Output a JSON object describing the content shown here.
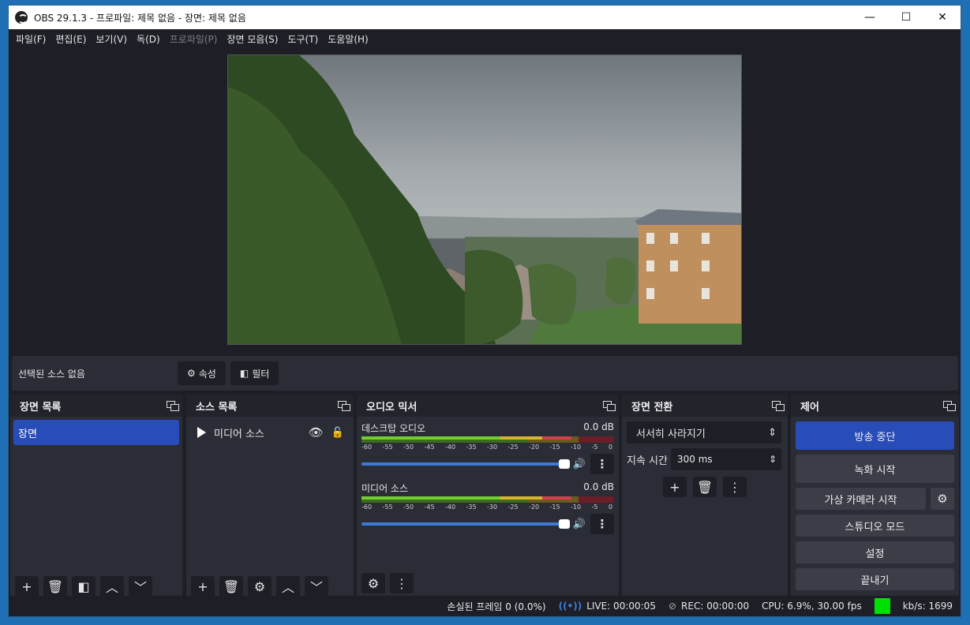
{
  "window": {
    "title": "OBS 29.1.3 - 프로파일: 제목 없음 - 장면: 제목 없음",
    "minimize": "—",
    "maximize": "☐",
    "close": "✕"
  },
  "menu": [
    {
      "label": "파일(F)",
      "enabled": true
    },
    {
      "label": "편집(E)",
      "enabled": true
    },
    {
      "label": "보기(V)",
      "enabled": true
    },
    {
      "label": "독(D)",
      "enabled": true
    },
    {
      "label": "프로파일(P)",
      "enabled": false
    },
    {
      "label": "장면 모음(S)",
      "enabled": true
    },
    {
      "label": "도구(T)",
      "enabled": true
    },
    {
      "label": "도움말(H)",
      "enabled": true
    }
  ],
  "source_bar": {
    "label": "선택된 소스 없음",
    "properties": "속성",
    "filters": "필터"
  },
  "scenes": {
    "title": "장면 목록",
    "items": [
      "장면"
    ]
  },
  "sources": {
    "title": "소스 목록",
    "items": [
      "미디어 소스"
    ]
  },
  "mixer": {
    "title": "오디오 믹서",
    "ticks": [
      "-60",
      "-55",
      "-50",
      "-45",
      "-40",
      "-35",
      "-30",
      "-25",
      "-20",
      "-15",
      "-10",
      "-5",
      "0"
    ],
    "channels": [
      {
        "name": "데스크탑 오디오",
        "level": "0.0 dB",
        "meter_fill": 0.83,
        "volume": 1.0
      },
      {
        "name": "미디어 소스",
        "level": "0.0 dB",
        "meter_fill": 0.83,
        "volume": 1.0
      }
    ]
  },
  "transitions": {
    "title": "장면 전환",
    "selected": "서서히 사라지기",
    "duration_label": "지속 시간",
    "duration_value": "300 ms"
  },
  "controls": {
    "title": "제어",
    "stop_stream": "방송 중단",
    "start_recording": "녹화 시작",
    "start_virtualcam": "가상 카메라 시작",
    "studio_mode": "스튜디오 모드",
    "settings": "설정",
    "exit": "끝내기"
  },
  "status": {
    "dropped_frames": "손실된 프레임 0 (0.0%)",
    "live": "LIVE: 00:00:05",
    "rec": "REC: 00:00:00",
    "cpu": "CPU: 6.9%, 30.00 fps",
    "kbps": "kb/s: 1699"
  },
  "colors": {
    "accent": "#284cb8",
    "panel": "#2a2c36",
    "background": "#1e1f26",
    "status_ok": "#00e000"
  }
}
